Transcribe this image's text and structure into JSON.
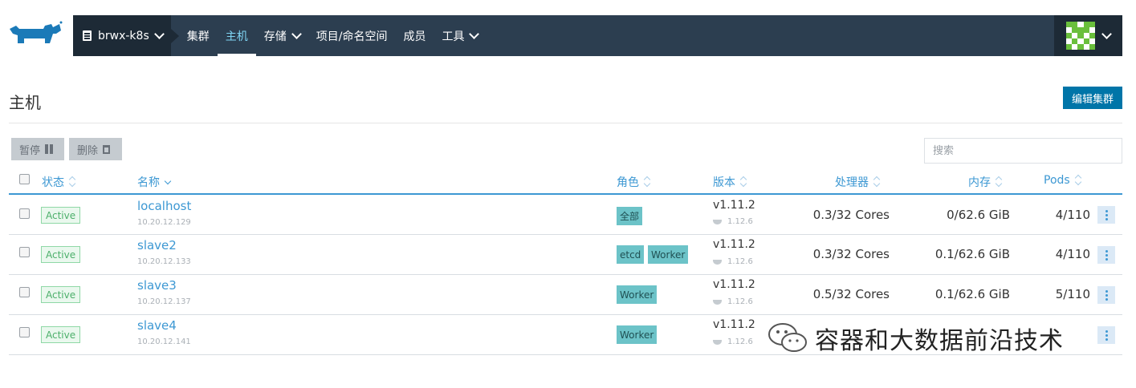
{
  "nav": {
    "cluster_name": "brwx-k8s",
    "items": [
      {
        "label": "集群",
        "dropdown": false,
        "active": false
      },
      {
        "label": "主机",
        "dropdown": false,
        "active": true
      },
      {
        "label": "存储",
        "dropdown": true,
        "active": false
      },
      {
        "label": "项目/命名空间",
        "dropdown": false,
        "active": false
      },
      {
        "label": "成员",
        "dropdown": false,
        "active": false
      },
      {
        "label": "工具",
        "dropdown": true,
        "active": false
      }
    ],
    "colors": {
      "bar": "#2c3e50",
      "dark": "#1d2a36",
      "active": "#7fd5f4"
    }
  },
  "page": {
    "title": "主机",
    "edit_button": "编辑集群",
    "pause_button": "暂停",
    "delete_button": "删除",
    "search_placeholder": "搜索"
  },
  "table": {
    "headers": {
      "state": "状态",
      "name": "名称",
      "roles": "角色",
      "version": "版本",
      "cpu": "处理器",
      "memory": "内存",
      "pods": "Pods"
    },
    "rows": [
      {
        "state": "Active",
        "name": "localhost",
        "ip": "10.20.12.129",
        "roles": [
          "全部"
        ],
        "version": "v1.11.2",
        "docker": "1.12.6",
        "cpu": "0.3/32 Cores",
        "memory": "0/62.6 GiB",
        "pods": "4/110"
      },
      {
        "state": "Active",
        "name": "slave2",
        "ip": "10.20.12.133",
        "roles": [
          "etcd",
          "Worker"
        ],
        "version": "v1.11.2",
        "docker": "1.12.6",
        "cpu": "0.3/32 Cores",
        "memory": "0.1/62.6 GiB",
        "pods": "4/110"
      },
      {
        "state": "Active",
        "name": "slave3",
        "ip": "10.20.12.137",
        "roles": [
          "Worker"
        ],
        "version": "v1.11.2",
        "docker": "1.12.6",
        "cpu": "0.5/32 Cores",
        "memory": "0.1/62.6 GiB",
        "pods": "5/110"
      },
      {
        "state": "Active",
        "name": "slave4",
        "ip": "10.20.12.141",
        "roles": [
          "Worker"
        ],
        "version": "v1.11.2",
        "docker": "1.12.6",
        "cpu": "",
        "memory": "",
        "pods": ""
      }
    ]
  },
  "watermark": {
    "text": "容器和大数据前沿技术"
  },
  "colors": {
    "primary": "#0075a8",
    "link": "#3d98d3",
    "active_badge": "#4caf6a",
    "role_badge": "#6cc3c8"
  }
}
